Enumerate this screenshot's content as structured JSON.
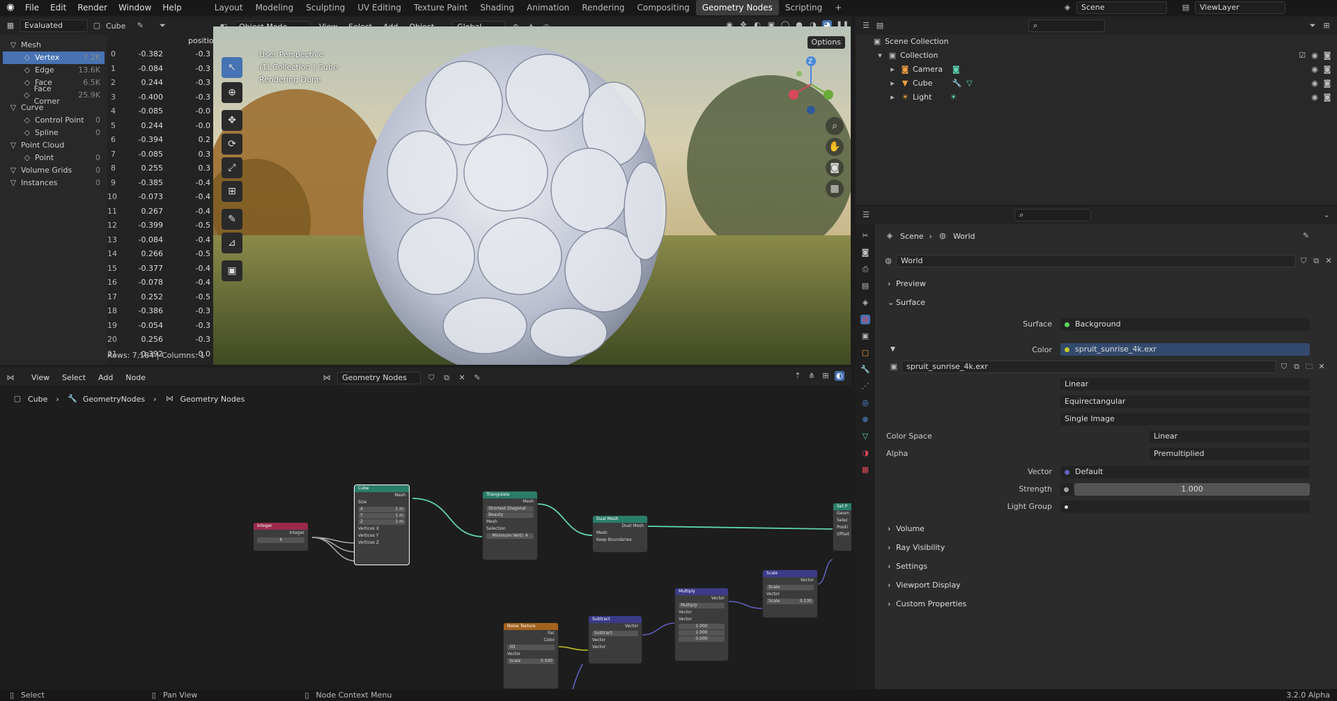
{
  "topbar": {
    "menus": [
      "File",
      "Edit",
      "Render",
      "Window",
      "Help"
    ],
    "workspaces": [
      "Layout",
      "Modeling",
      "Sculpting",
      "UV Editing",
      "Texture Paint",
      "Shading",
      "Animation",
      "Rendering",
      "Compositing",
      "Geometry Nodes",
      "Scripting"
    ],
    "active_workspace": "Geometry Nodes",
    "scene_name": "Scene",
    "view_layer": "ViewLayer"
  },
  "spreadsheet": {
    "mode": "Evaluated",
    "object": "Cube",
    "column_header": "positio",
    "tree": [
      {
        "label": "Mesh",
        "count": "",
        "level": 0
      },
      {
        "label": "Vertex",
        "count": "7.2K",
        "level": 1,
        "selected": true
      },
      {
        "label": "Edge",
        "count": "13.6K",
        "level": 1
      },
      {
        "label": "Face",
        "count": "6.5K",
        "level": 1
      },
      {
        "label": "Face Corner",
        "count": "25.9K",
        "level": 1
      },
      {
        "label": "Curve",
        "count": "",
        "level": 0
      },
      {
        "label": "Control Point",
        "count": "0",
        "level": 1
      },
      {
        "label": "Spline",
        "count": "0",
        "level": 1
      },
      {
        "label": "Point Cloud",
        "count": "",
        "level": 0
      },
      {
        "label": "Point",
        "count": "0",
        "level": 1
      },
      {
        "label": "Volume Grids",
        "count": "0",
        "level": 0
      },
      {
        "label": "Instances",
        "count": "0",
        "level": 0
      }
    ],
    "rows": [
      {
        "i": "0",
        "a": "-0.382",
        "b": "-0.3"
      },
      {
        "i": "1",
        "a": "-0.084",
        "b": "-0.3"
      },
      {
        "i": "2",
        "a": "0.244",
        "b": "-0.3"
      },
      {
        "i": "3",
        "a": "-0.400",
        "b": "-0.3"
      },
      {
        "i": "4",
        "a": "-0.085",
        "b": "-0.0"
      },
      {
        "i": "5",
        "a": "0.244",
        "b": "-0.0"
      },
      {
        "i": "6",
        "a": "-0.394",
        "b": "0.2"
      },
      {
        "i": "7",
        "a": "-0.085",
        "b": "0.3"
      },
      {
        "i": "8",
        "a": "0.255",
        "b": "0.3"
      },
      {
        "i": "9",
        "a": "-0.385",
        "b": "-0.4"
      },
      {
        "i": "10",
        "a": "-0.073",
        "b": "-0.4"
      },
      {
        "i": "11",
        "a": "0.267",
        "b": "-0.4"
      },
      {
        "i": "12",
        "a": "-0.399",
        "b": "-0.5"
      },
      {
        "i": "13",
        "a": "-0.084",
        "b": "-0.4"
      },
      {
        "i": "14",
        "a": "0.266",
        "b": "-0.5"
      },
      {
        "i": "15",
        "a": "-0.377",
        "b": "-0.4"
      },
      {
        "i": "16",
        "a": "-0.078",
        "b": "-0.4"
      },
      {
        "i": "17",
        "a": "0.252",
        "b": "-0.5"
      },
      {
        "i": "18",
        "a": "-0.386",
        "b": "-0.3"
      },
      {
        "i": "19",
        "a": "-0.054",
        "b": "-0.3"
      },
      {
        "i": "20",
        "a": "0.256",
        "b": "-0.3"
      },
      {
        "i": "21",
        "a": "-0.392",
        "b": "-0.0"
      }
    ],
    "footer": "Rows: 7,184  |  Columns: 1"
  },
  "viewport": {
    "mode": "Object Mode",
    "menus": [
      "View",
      "Select",
      "Add",
      "Object"
    ],
    "orientation": "Global",
    "options": "Options",
    "overlay_lines": [
      "User Perspective",
      "(1) Collection | Cube",
      "Rendering Done"
    ]
  },
  "node_editor": {
    "menus": [
      "View",
      "Select",
      "Add",
      "Node"
    ],
    "tree_name": "Geometry Nodes",
    "breadcrumb": [
      "Cube",
      "GeometryNodes",
      "Geometry Nodes"
    ],
    "nodes": {
      "integer": {
        "title": "Integer",
        "out": "Integer",
        "value": "4"
      },
      "cube": {
        "title": "Cube",
        "out": "Mesh",
        "size": "Size",
        "x": "X",
        "xv": "1 m",
        "y": "Y",
        "yv": "1 m",
        "z": "Z",
        "zv": "1 m",
        "vx": "Vertices X",
        "vy": "Vertices Y",
        "vz": "Vertices Z"
      },
      "triangulate": {
        "title": "Triangulate",
        "out": "Mesh",
        "quad": "Shortest Diagonal",
        "ngon": "Beauty",
        "mesh": "Mesh",
        "sel": "Selection",
        "min": "Minimum Verti: 4"
      },
      "dual": {
        "title": "Dual Mesh",
        "out": "Dual Mesh",
        "mesh": "Mesh",
        "keep": "Keep Boundaries"
      },
      "setpos": {
        "title": "Set P",
        "g": "Geom",
        "s": "Selec",
        "p": "Positi",
        "o": "Offset"
      },
      "noise": {
        "title": "Noise Texture",
        "fac": "Fac",
        "color": "Color",
        "dim": "3D",
        "vec": "Vector",
        "scale": "Scale",
        "scalev": "0.500"
      },
      "subtract": {
        "title": "Subtract",
        "out": "Vector",
        "op": "Subtract",
        "a": "Vector",
        "b": "Vector"
      },
      "multiply": {
        "title": "Multiply",
        "out": "Vector",
        "op": "Multiply",
        "a": "Vector",
        "b": "Vector",
        "v1": "1.000",
        "v2": "1.000",
        "v3": "0.000"
      },
      "scale": {
        "title": "Scale",
        "out": "Vector",
        "op": "Scale",
        "a": "Vector",
        "s": "Scale",
        "sv": "0.130"
      }
    }
  },
  "outliner": {
    "root": "Scene Collection",
    "collection": "Collection",
    "items": [
      "Camera",
      "Cube",
      "Light"
    ]
  },
  "properties": {
    "breadcrumb": [
      "Scene",
      "World"
    ],
    "world_name": "World",
    "sections_top": [
      "Preview",
      "Surface"
    ],
    "surface_label": "Surface",
    "surface_value": "Background",
    "color_label": "Color",
    "color_value": "spruit_sunrise_4k.exr",
    "image_name": "spruit_sunrise_4k.exr",
    "interp": "Linear",
    "projection": "Equirectangular",
    "source": "Single Image",
    "colorspace_label": "Color Space",
    "colorspace_value": "Linear",
    "alpha_label": "Alpha",
    "alpha_value": "Premultiplied",
    "vector_label": "Vector",
    "vector_value": "Default",
    "strength_label": "Strength",
    "strength_value": "1.000",
    "lightgroup_label": "Light Group",
    "sections_bottom": [
      "Volume",
      "Ray Visibility",
      "Settings",
      "Viewport Display",
      "Custom Properties"
    ]
  },
  "statusbar": {
    "select": "Select",
    "pan": "Pan View",
    "ctx": "Node Context Menu",
    "version": "3.2.0 Alpha"
  }
}
